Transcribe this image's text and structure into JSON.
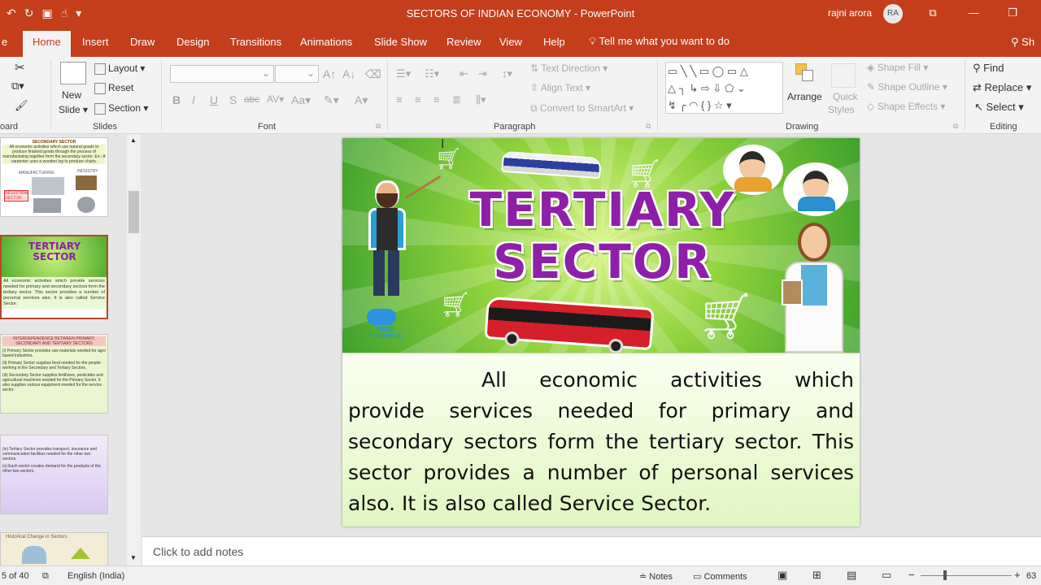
{
  "titlebar": {
    "title": "SECTORS OF INDIAN ECONOMY  -  PowerPoint",
    "user": "rajni arora",
    "initials": "RA"
  },
  "tabs": {
    "home": "Home",
    "insert": "Insert",
    "draw": "Draw",
    "design": "Design",
    "transitions": "Transitions",
    "animations": "Animations",
    "slideshow": "Slide Show",
    "review": "Review",
    "view": "View",
    "help": "Help",
    "tellme": "Tell me what you want to do",
    "share": "Sh"
  },
  "ribbon": {
    "clipboard_group": "oard",
    "new_slide_line1": "New",
    "new_slide_line2": "Slide",
    "layout": "Layout",
    "reset": "Reset",
    "section": "Section",
    "slides_group": "Slides",
    "font_group": "Font",
    "text_direction": "Text Direction",
    "align_text": "Align Text",
    "convert_smartart": "Convert to SmartArt",
    "paragraph_group": "Paragraph",
    "arrange": "Arrange",
    "quick_styles_1": "Quick",
    "quick_styles_2": "Styles",
    "shape_fill": "Shape Fill",
    "shape_outline": "Shape Outline",
    "shape_effects": "Shape Effects",
    "drawing_group": "Drawing",
    "find": "Find",
    "replace": "Replace",
    "select": "Select",
    "editing_group": "Editing"
  },
  "thumbs": {
    "t1_title": "SECONDARY SECTOR",
    "t1_text": "All economic activities which use natural goods to produce finished goods through the process of manufacturing together form the secondary sector. Ex:- A carpenter uses a wooden log to produce chairs.",
    "t1_l1": "MANUFACTURING",
    "t1_l2": "INDUSTRY",
    "t1_l3": "INDUSTRIAL SECTOR",
    "t2_text": "All economic activities which provide services needed for primary and secondary sectors form the tertiary sector. This sector provides a number of personal services also. It is also called Service Sector.",
    "t3_title": "INTERDEPENDENCE BETWEEN PRIMARY, SECONDARY AND TERTIARY SECTORS",
    "t3_p1": "(i) Primary Sector provides raw materials needed for agro based industries.",
    "t3_p2": "(ii) Primary Sector supplies food needed for the people working in the Secondary and Tertiary Sectors.",
    "t3_p3": "(iii) Secondary Sector supplies fertilizers, pesticides and agricultural machines needed for the Primary Sector. It also supplies various equipment needed for the service sector.",
    "t4_p1": "(iv) Tertiary Sector provides transport, insurance and communication facilities needed for the other two sectors.",
    "t4_p2": "(v) Each sector creates demand for the products of the other two sectors.",
    "t5_title": "Historical Change in Sectors"
  },
  "slide": {
    "headline_1": "TERTIARY",
    "headline_2": "SECTOR",
    "logo": "Happ Learning",
    "body": "All economic activities which provide services needed for primary and secondary sectors form the tertiary sector. This sector provides a number of personal services also. It is also called Service Sector."
  },
  "notes": {
    "placeholder": "Click to add notes"
  },
  "status": {
    "slide_count": "5 of 40",
    "language": "English (India)",
    "notes": "Notes",
    "comments": "Comments",
    "zoom": "63"
  }
}
